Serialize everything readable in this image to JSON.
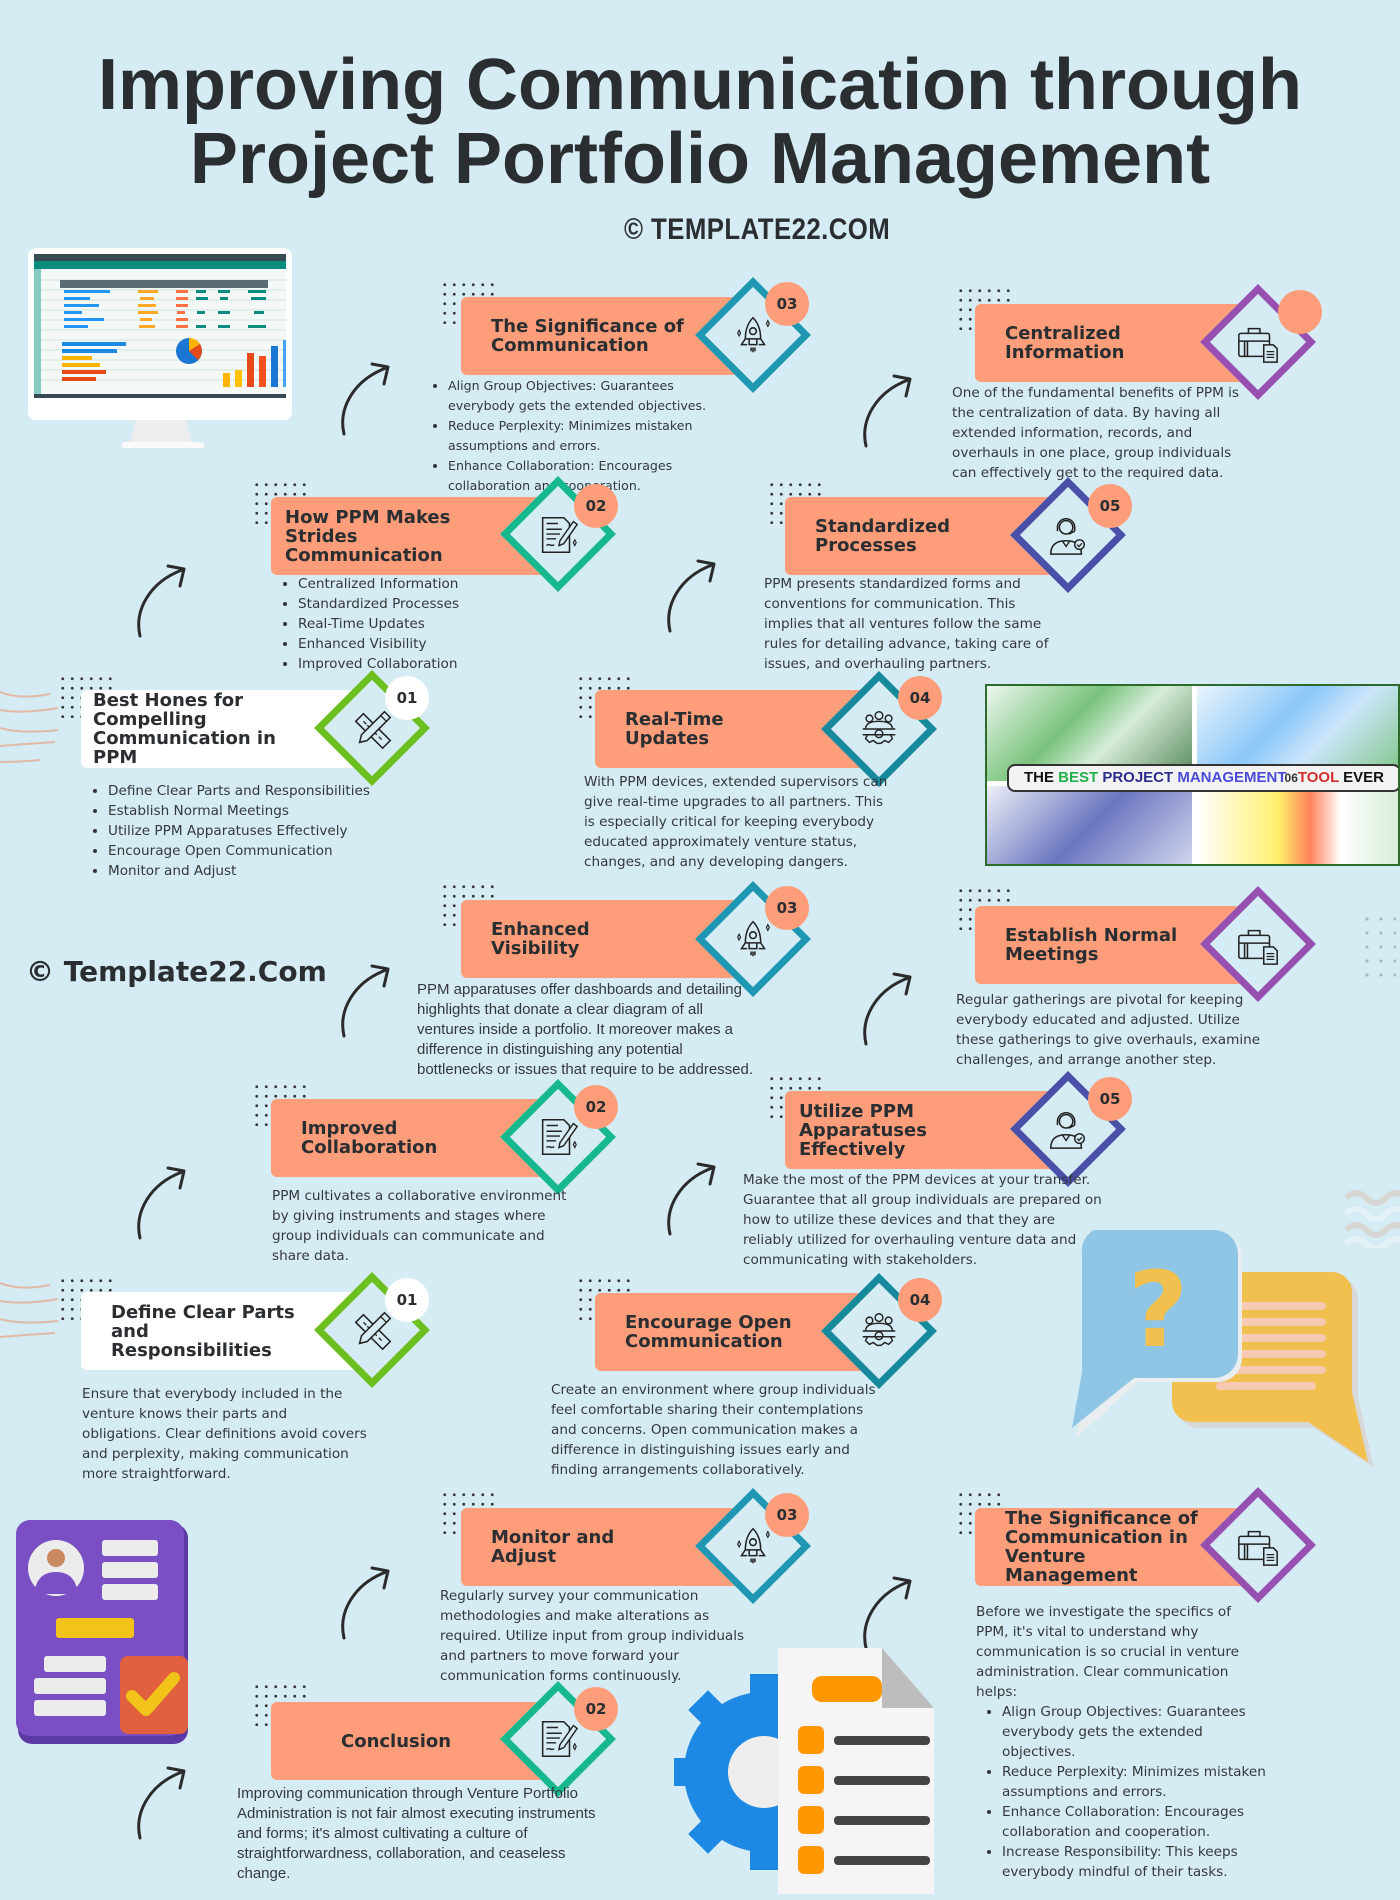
{
  "header": {
    "title_line1": "Improving Communication through",
    "title_line2": "Project Portfolio Management",
    "watermark_top": "© TEMPLATE22.COM",
    "watermark_mid": "© Template22.Com"
  },
  "colors": {
    "background": "#d5ecf4",
    "card_orange": "#fe9d7a",
    "teal": "#1f97b3",
    "green": "#15b98d",
    "lime": "#6cbf1f",
    "purple": "#9750b0",
    "indigo": "#4a50a8",
    "text": "#2b2e31"
  },
  "banner": {
    "parts": [
      "THE",
      "BEST",
      "PROJECT",
      "MANAGEMENT",
      "06",
      "TOOL",
      "EVER"
    ]
  },
  "cards": [
    {
      "id": "significance-communication",
      "title": "The Significance of Communication",
      "badge": "03",
      "icon": "rocket-icon",
      "bullets": [
        "Align Group Objectives: Guarantees everybody gets the extended objectives.",
        "Reduce Perplexity: Minimizes mistaken assumptions and errors.",
        "Enhance Collaboration: Encourages collaboration and cooperation."
      ]
    },
    {
      "id": "centralized-information",
      "title": "Centralized Information",
      "badge": "",
      "icon": "briefcase-document-icon",
      "text": "One of the fundamental benefits of PPM is the centralization of data. By having all extended information, records, and overhauls in one place, group individuals can effectively get to the required data."
    },
    {
      "id": "how-ppm-makes-strides",
      "title": "How PPM Makes Strides Communication",
      "badge": "02",
      "icon": "contract-pen-icon",
      "bullets": [
        "Centralized Information",
        "Standardized Processes",
        "Real-Time Updates",
        "Enhanced Visibility",
        "Improved Collaboration"
      ]
    },
    {
      "id": "standardized-processes",
      "title": "Standardized Processes",
      "badge": "05",
      "icon": "support-agent-icon",
      "text": "PPM presents standardized forms and conventions for communication. This implies that all ventures follow the same rules for detailing advance, taking care of issues, and overhauling partners."
    },
    {
      "id": "best-hones",
      "title": "Best Hones for Compelling Communication in PPM",
      "badge": "01",
      "icon": "ruler-pencil-icon",
      "bullets": [
        "Define Clear Parts and Responsibilities",
        "Establish Normal Meetings",
        "Utilize PPM Apparatuses Effectively",
        "Encourage Open Communication",
        "Monitor and Adjust"
      ]
    },
    {
      "id": "real-time-updates",
      "title": "Real-Time Updates",
      "badge": "04",
      "icon": "team-gear-icon",
      "text": "With PPM devices, extended supervisors can give real-time upgrades to all partners. This is especially critical for keeping everybody educated approximately venture status, changes, and any developing dangers."
    },
    {
      "id": "enhanced-visibility",
      "title": "Enhanced Visibility",
      "badge": "03",
      "icon": "rocket-icon",
      "text": "PPM apparatuses offer dashboards and detailing highlights that donate a clear diagram of all ventures inside a portfolio. It moreover makes a difference in distinguishing any potential bottlenecks or issues that require to be addressed."
    },
    {
      "id": "establish-normal-meetings",
      "title": "Establish Normal Meetings",
      "badge": "",
      "icon": "briefcase-document-icon",
      "text": "Regular gatherings are pivotal for keeping everybody educated and adjusted. Utilize these gatherings to give overhauls, examine challenges, and arrange another step."
    },
    {
      "id": "improved-collaboration",
      "title": "Improved Collaboration",
      "badge": "02",
      "icon": "contract-pen-icon",
      "text": "PPM cultivates a collaborative environment by giving instruments and stages where group individuals can communicate and share data."
    },
    {
      "id": "utilize-ppm",
      "title": "Utilize PPM Apparatuses Effectively",
      "badge": "05",
      "icon": "support-agent-icon",
      "text": "Make the most of the PPM devices at your transfer. Guarantee that all group individuals are prepared on how to utilize these devices and that they are reliably utilized for overhauling venture data and communicating with stakeholders."
    },
    {
      "id": "define-clear-parts",
      "title": "Define Clear Parts and Responsibilities",
      "badge": "01",
      "icon": "ruler-pencil-icon",
      "text": "Ensure that everybody included in the venture knows their parts and obligations. Clear definitions avoid covers and perplexity, making communication more straightforward."
    },
    {
      "id": "encourage-open",
      "title": "Encourage Open Communication",
      "badge": "04",
      "icon": "team-gear-icon",
      "text": "Create an environment where group individuals feel comfortable sharing their contemplations and concerns. Open communication makes a difference in distinguishing issues early and finding arrangements collaboratively."
    },
    {
      "id": "monitor-adjust",
      "title": "Monitor and Adjust",
      "badge": "03",
      "icon": "rocket-icon",
      "text": "Regularly survey your communication methodologies and make alterations as required. Utilize input from group individuals and partners to move forward your communication forms continuously."
    },
    {
      "id": "significance-venture",
      "title": "The Significance of Communication in Venture Management",
      "badge": "",
      "icon": "briefcase-document-icon",
      "text": "Before we investigate the specifics of PPM, it's vital to understand why communication is so crucial in venture administration. Clear communication helps:",
      "bullets": [
        "Align Group Objectives: Guarantees everybody gets the extended objectives.",
        "Reduce Perplexity: Minimizes mistaken assumptions and errors.",
        "Enhance Collaboration: Encourages collaboration and cooperation.",
        "Increase Responsibility: This keeps everybody mindful of their tasks."
      ]
    },
    {
      "id": "conclusion",
      "title": "Conclusion",
      "badge": "02",
      "icon": "contract-pen-icon",
      "text": "Improving communication through Venture Portfolio Administration is not fair almost executing instruments and forms; it's almost cultivating a culture of straightforwardness, collaboration, and ceaseless change."
    }
  ]
}
